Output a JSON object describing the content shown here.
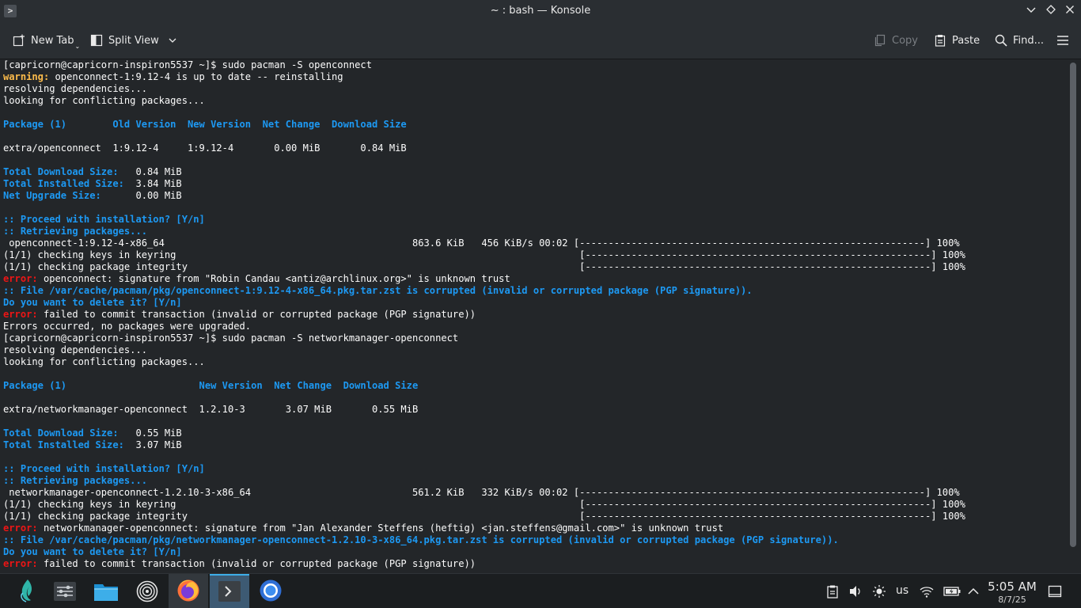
{
  "window": {
    "title": "~ : bash — Konsole"
  },
  "toolbar": {
    "new_tab": "New Tab",
    "split_view": "Split View",
    "copy": "Copy",
    "paste": "Paste",
    "find": "Find..."
  },
  "terminal": {
    "lines": [
      [
        {
          "t": "[capricorn@capricorn-inspiron5537 ~]$ sudo pacman -S openconnect",
          "c": ""
        }
      ],
      [
        {
          "t": "warning:",
          "c": "y"
        },
        {
          "t": " openconnect-1:9.12-4 is up to date -- reinstalling",
          "c": ""
        }
      ],
      [
        {
          "t": "resolving dependencies...",
          "c": ""
        }
      ],
      [
        {
          "t": "looking for conflicting packages...",
          "c": ""
        }
      ],
      [
        {
          "t": "",
          "c": ""
        }
      ],
      [
        {
          "t": "Package (1)        Old Version  New Version  Net Change  Download Size",
          "c": "b"
        }
      ],
      [
        {
          "t": "",
          "c": ""
        }
      ],
      [
        {
          "t": "extra/openconnect  1:9.12-4     1:9.12-4       0.00 MiB       0.84 MiB",
          "c": ""
        }
      ],
      [
        {
          "t": "",
          "c": ""
        }
      ],
      [
        {
          "t": "Total Download Size:",
          "c": "b"
        },
        {
          "t": "   0.84 MiB",
          "c": ""
        }
      ],
      [
        {
          "t": "Total Installed Size:",
          "c": "b"
        },
        {
          "t": "  3.84 MiB",
          "c": ""
        }
      ],
      [
        {
          "t": "Net Upgrade Size:",
          "c": "b"
        },
        {
          "t": "      0.00 MiB",
          "c": ""
        }
      ],
      [
        {
          "t": "",
          "c": ""
        }
      ],
      [
        {
          "t": ":: Proceed with installation? [Y/n]",
          "c": "b"
        }
      ],
      [
        {
          "t": ":: Retrieving packages...",
          "c": "b"
        }
      ],
      [
        {
          "t": " openconnect-1:9.12-4-x86_64                                           863.6 KiB   456 KiB/s 00:02 [------------------------------------------------------------] 100%",
          "c": ""
        }
      ],
      [
        {
          "t": "(1/1) checking keys in keyring                                                                      [------------------------------------------------------------] 100%",
          "c": ""
        }
      ],
      [
        {
          "t": "(1/1) checking package integrity                                                                    [------------------------------------------------------------] 100%",
          "c": ""
        }
      ],
      [
        {
          "t": "error:",
          "c": "r"
        },
        {
          "t": " openconnect: signature from \"Robin Candau <antiz@archlinux.org>\" is unknown trust",
          "c": ""
        }
      ],
      [
        {
          "t": ":: File /var/cache/pacman/pkg/openconnect-1:9.12-4-x86_64.pkg.tar.zst is corrupted (invalid or corrupted package (PGP signature)).",
          "c": "b"
        }
      ],
      [
        {
          "t": "Do you want to delete it? [Y/n]",
          "c": "b"
        }
      ],
      [
        {
          "t": "error:",
          "c": "r"
        },
        {
          "t": " failed to commit transaction (invalid or corrupted package (PGP signature))",
          "c": ""
        }
      ],
      [
        {
          "t": "Errors occurred, no packages were upgraded.",
          "c": ""
        }
      ],
      [
        {
          "t": "[capricorn@capricorn-inspiron5537 ~]$ sudo pacman -S networkmanager-openconnect",
          "c": ""
        }
      ],
      [
        {
          "t": "resolving dependencies...",
          "c": ""
        }
      ],
      [
        {
          "t": "looking for conflicting packages...",
          "c": ""
        }
      ],
      [
        {
          "t": "",
          "c": ""
        }
      ],
      [
        {
          "t": "Package (1)                       New Version  Net Change  Download Size",
          "c": "b"
        }
      ],
      [
        {
          "t": "",
          "c": ""
        }
      ],
      [
        {
          "t": "extra/networkmanager-openconnect  1.2.10-3       3.07 MiB       0.55 MiB",
          "c": ""
        }
      ],
      [
        {
          "t": "",
          "c": ""
        }
      ],
      [
        {
          "t": "Total Download Size:",
          "c": "b"
        },
        {
          "t": "   0.55 MiB",
          "c": ""
        }
      ],
      [
        {
          "t": "Total Installed Size:",
          "c": "b"
        },
        {
          "t": "  3.07 MiB",
          "c": ""
        }
      ],
      [
        {
          "t": "",
          "c": ""
        }
      ],
      [
        {
          "t": ":: Proceed with installation? [Y/n]",
          "c": "b"
        }
      ],
      [
        {
          "t": ":: Retrieving packages...",
          "c": "b"
        }
      ],
      [
        {
          "t": " networkmanager-openconnect-1.2.10-3-x86_64                            561.2 KiB   332 KiB/s 00:02 [------------------------------------------------------------] 100%",
          "c": ""
        }
      ],
      [
        {
          "t": "(1/1) checking keys in keyring                                                                      [------------------------------------------------------------] 100%",
          "c": ""
        }
      ],
      [
        {
          "t": "(1/1) checking package integrity                                                                    [------------------------------------------------------------] 100%",
          "c": ""
        }
      ],
      [
        {
          "t": "error:",
          "c": "r"
        },
        {
          "t": " networkmanager-openconnect: signature from \"Jan Alexander Steffens (heftig) <jan.steffens@gmail.com>\" is unknown trust",
          "c": ""
        }
      ],
      [
        {
          "t": ":: File /var/cache/pacman/pkg/networkmanager-openconnect-1.2.10-3-x86_64.pkg.tar.zst is corrupted (invalid or corrupted package (PGP signature)).",
          "c": "b"
        }
      ],
      [
        {
          "t": "Do you want to delete it? [Y/n]",
          "c": "b"
        }
      ],
      [
        {
          "t": "error:",
          "c": "r"
        },
        {
          "t": " failed to commit transaction (invalid or corrupted package (PGP signature))",
          "c": ""
        }
      ]
    ]
  },
  "taskbar": {
    "apps": [
      {
        "name": "app-launcher-icon"
      },
      {
        "name": "system-settings-icon"
      },
      {
        "name": "file-manager-icon"
      },
      {
        "name": "vinyl-app-icon"
      },
      {
        "name": "firefox-icon"
      },
      {
        "name": "konsole-icon"
      },
      {
        "name": "chromium-icon"
      }
    ],
    "keyboard_layout": "us",
    "time": "5:05 AM",
    "date": "8/7/25"
  },
  "colors": {
    "accent": "#3daee9",
    "term_blue": "#1d99f3",
    "term_yellow": "#fdbc4b",
    "term_red": "#ed1515"
  }
}
